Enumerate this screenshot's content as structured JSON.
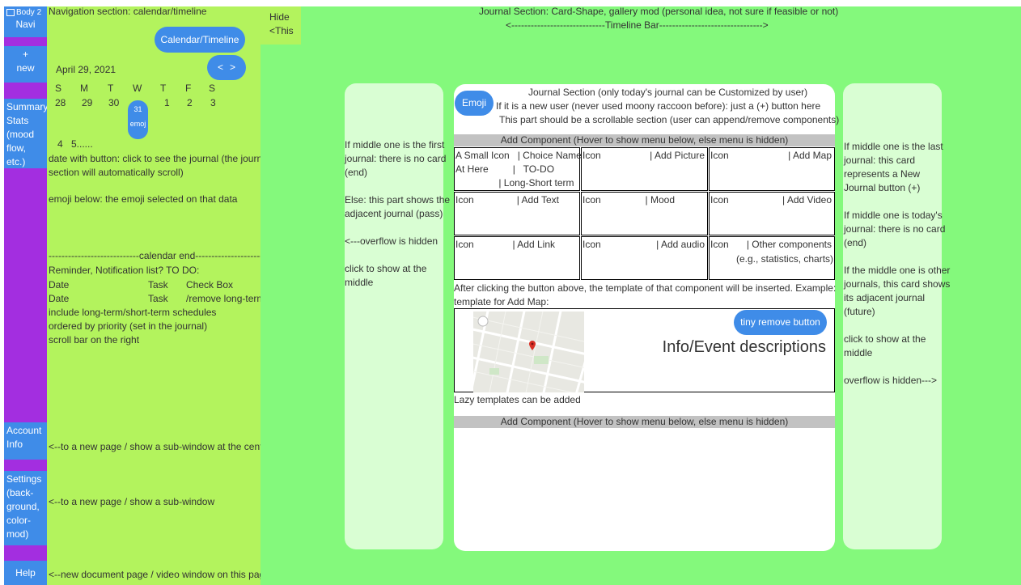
{
  "nav": {
    "body_label": "Body 2",
    "navi": "Navi",
    "new_plus": "+",
    "new_label": "new",
    "summary": [
      "Summary",
      "Stats",
      "(mood",
      "flow, etc.)"
    ],
    "account": [
      "Account",
      "Info"
    ],
    "settings": [
      "Settings",
      "(back-",
      "ground,",
      "color-",
      "mod)"
    ],
    "help": "Help"
  },
  "navpanel": {
    "title": "Navigation section: calendar/timeline",
    "calendar_button": "Calendar/Timeline",
    "date": "April 29, 2021",
    "prev": "<",
    "next": ">",
    "weekdays": [
      "S",
      "M",
      "T",
      "W",
      "T",
      "F",
      "S"
    ],
    "week1": [
      "28",
      "29",
      "30",
      "31",
      "1",
      "2",
      "3"
    ],
    "today_emoji": "emoj",
    "week2_a": "4",
    "week2_b": "5......",
    "desc1": [
      "date with button: click to see the journal (the journal",
      "section will automatically scroll)"
    ],
    "desc2": "emoji below: the emoji selected on that data",
    "calendar_end": "----------------------------calendar end--------------------------",
    "reminder_lines": [
      "Reminder, Notification list? TO DO:"
    ],
    "reminder_header": {
      "c1": "Date",
      "c2": "Task",
      "c3": "Check Box"
    },
    "reminder_row": {
      "c1": "Date",
      "c2": "Task",
      "c3": "/remove long-term"
    },
    "reminder_more": [
      "include long-term/short-term schedules",
      "ordered by priority (set in the journal)",
      "scroll bar on the right"
    ],
    "account_note": "<--to a new page / show a sub-window at the center",
    "settings_note": "<--to a new page / show a sub-window",
    "help_note": "<--new document page / video window on this page"
  },
  "hide": [
    "Hide",
    "<This"
  ],
  "header": {
    "line1": "Journal Section: Card-Shape, gallery mod (personal idea, not sure if feasible or not)",
    "line2": "<-----------------------------Timeline Bar-------------------------------->"
  },
  "left_card": {
    "p1": [
      "If middle one is the first",
      "journal: there is no card",
      "(end)"
    ],
    "p2": [
      "Else: this part shows the",
      "adjacent journal (pass)"
    ],
    "p3": "<---overflow is hidden",
    "p4": [
      "click to show at the",
      "middle"
    ]
  },
  "right_card": {
    "p1": [
      "If middle one is the last",
      "journal: this card",
      "represents a New",
      "Journal button (+)"
    ],
    "p2": [
      "If middle one is today's",
      "journal: there is no card",
      "(end)"
    ],
    "p3": [
      "If the middle one is other",
      "journals, this card shows",
      "its adjacent journal",
      "(future)"
    ],
    "p4": [
      "click to show at the",
      "middle"
    ],
    "p5": "overflow is hidden--->"
  },
  "center": {
    "emoji_button": "Emoji",
    "l1": "Journal Section (only today's journal can be Customized by user)",
    "l2": "If it is a new user (never used moony raccoon before): just a (+) button here",
    "l3": "This part should be a scrollable section (user can append/remove components)",
    "add_component": "Add Component (Hover to show menu below, else menu is hidden)",
    "grid": {
      "c1": {
        "lines": [
          "A Small Icon   | Choice Name:",
          "At Here         |   TO-DO",
          "                | Long-Short term"
        ]
      },
      "c2": {
        "a": "Icon",
        "b": "| Add Picture"
      },
      "c3": {
        "a": "Icon",
        "b": "| Add Map"
      },
      "c4": {
        "a": "Icon",
        "b": "| Add Text"
      },
      "c5": {
        "a": "Icon",
        "b": "| Mood"
      },
      "c6": {
        "a": "Icon",
        "b": "| Add Video"
      },
      "c7": {
        "a": "Icon",
        "b": "| Add Link"
      },
      "c8": {
        "a": "Icon",
        "b": "| Add audio"
      },
      "c9": {
        "a": "Icon",
        "b": "| Other components",
        "c": "(e.g., statistics, charts)"
      }
    },
    "after_text": [
      "After clicking the button above, the template of that component will be inserted. Example:",
      "template for Add Map:"
    ],
    "remove_button": "tiny remove button",
    "info": "Info/Event descriptions",
    "lazy": "Lazy templates can be added"
  },
  "colors": {
    "nav_purple": "#a32ee0",
    "panel_green": "#b3f35d",
    "main_green": "#84f97c",
    "button_blue": "#3f8ce8",
    "card_light": "#d9fed3"
  }
}
